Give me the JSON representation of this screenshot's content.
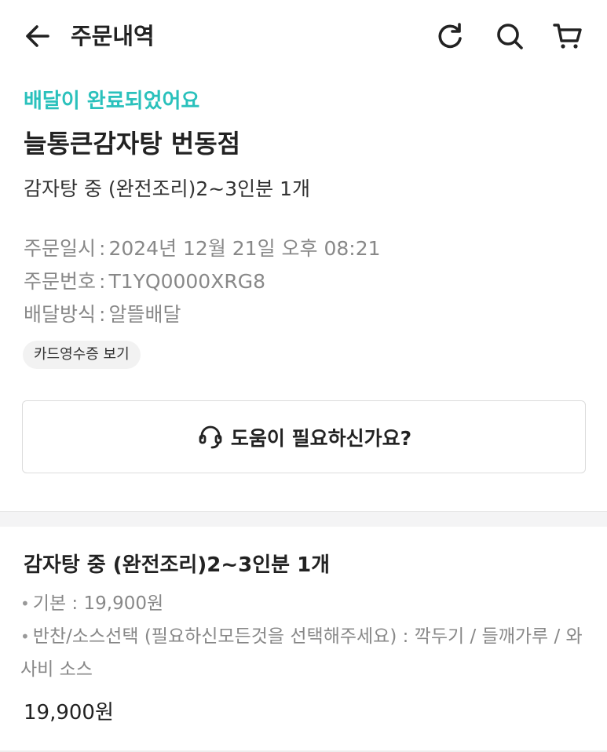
{
  "header": {
    "title": "주문내역",
    "icons": [
      "arrow-left-icon",
      "refresh-icon",
      "search-icon",
      "cart-icon"
    ]
  },
  "order": {
    "status": "배달이 완료되었어요",
    "status_color": "#2ac1bc",
    "store_name": "늘통큰감자탕 번동점",
    "menu_summary": "감자탕 중 (완전조리)2~3인분 1개",
    "info": [
      {
        "label": "주문일시",
        "sep": ":",
        "value": "2024년 12월 21일 오후 08:21"
      },
      {
        "label": "주문번호",
        "sep": ":",
        "value": "T1YQ0000XRG8"
      },
      {
        "label": "배달방식",
        "sep": ":",
        "value": "알뜰배달"
      }
    ],
    "receipt_button": "카드영수증 보기",
    "help_button": "도움이 필요하신가요?"
  },
  "item": {
    "title": "감자탕 중 (완전조리)2~3인분 1개",
    "options": [
      "기본 : 19,900원",
      "반찬/소스선택 (필요하신모든것을 선택해주세요) : 깍두기 / 들깨가루 / 와사비 소스"
    ],
    "bullet": "•",
    "price": "19,900원"
  }
}
